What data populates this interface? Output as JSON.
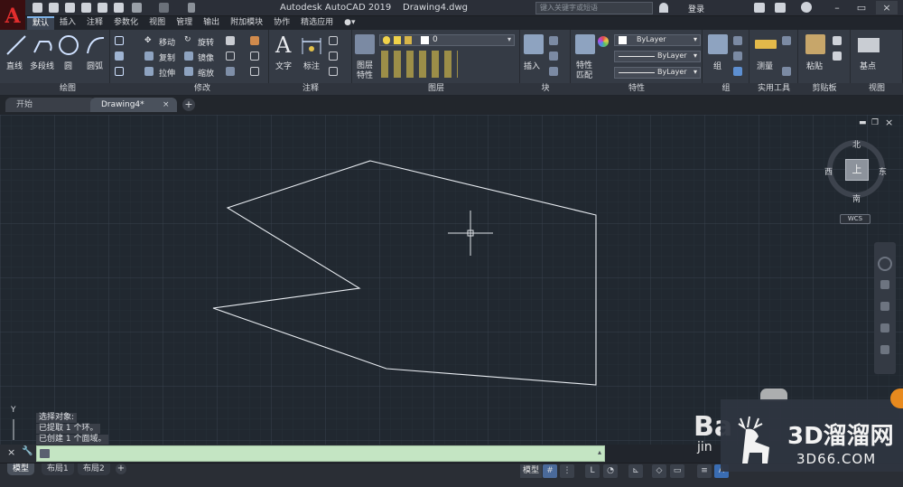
{
  "app": {
    "title": "Autodesk AutoCAD 2019",
    "filename": "Drawing4.dwg",
    "search_placeholder": "键入关键字或短语",
    "login": "登录"
  },
  "ribbon_tabs": [
    "默认",
    "插入",
    "注释",
    "参数化",
    "视图",
    "管理",
    "输出",
    "附加模块",
    "协作",
    "精选应用"
  ],
  "draw_panel": {
    "title": "绘图",
    "tools": [
      "直线",
      "多段线",
      "圆",
      "圆弧"
    ]
  },
  "modify_panel": {
    "title": "修改",
    "tools": [
      "移动",
      "旋转",
      "复制",
      "镜像",
      "拉伸",
      "缩放"
    ]
  },
  "annotation_panel": {
    "title": "注释",
    "tools": [
      "文字",
      "标注"
    ]
  },
  "layers_panel": {
    "title": "图层",
    "tool_line1": "图层",
    "tool_line2": "特性",
    "current_layer": "0"
  },
  "block_panel": {
    "title": "块",
    "tool": "插入"
  },
  "properties_panel": {
    "title": "特性",
    "tool_line1": "特性",
    "tool_line2": "匹配",
    "color": "ByLayer",
    "linetype": "ByLayer",
    "lineweight": "ByLayer"
  },
  "group_panel": {
    "title": "组",
    "tool": "组"
  },
  "utilities_panel": {
    "title": "实用工具",
    "tool": "测量"
  },
  "clipboard_panel": {
    "title": "剪贴板",
    "tool": "粘贴"
  },
  "view_panel": {
    "title": "视图",
    "tool": "基点"
  },
  "file_tabs": [
    "开始",
    "Drawing4*"
  ],
  "viewcube": {
    "north": "北",
    "south": "南",
    "east": "东",
    "west": "西",
    "face": "上",
    "wcs": "WCS"
  },
  "ucs_axis": "Y",
  "command_history": [
    "选择对象:",
    "已提取 1 个环。",
    "已创建 1 个面域。"
  ],
  "layout_tabs": [
    "模型",
    "布局1",
    "布局2"
  ],
  "status": {
    "model": "模型"
  },
  "watermark": {
    "brand": "3D溜溜网",
    "site": "3D66.COM",
    "baidu": "Ba",
    "baidu_sub": "jin"
  },
  "colors": {
    "accent": "#7db2e8",
    "canvas": "#212830",
    "command_input": "#c4e5c3",
    "logo": "#e22d2d"
  }
}
